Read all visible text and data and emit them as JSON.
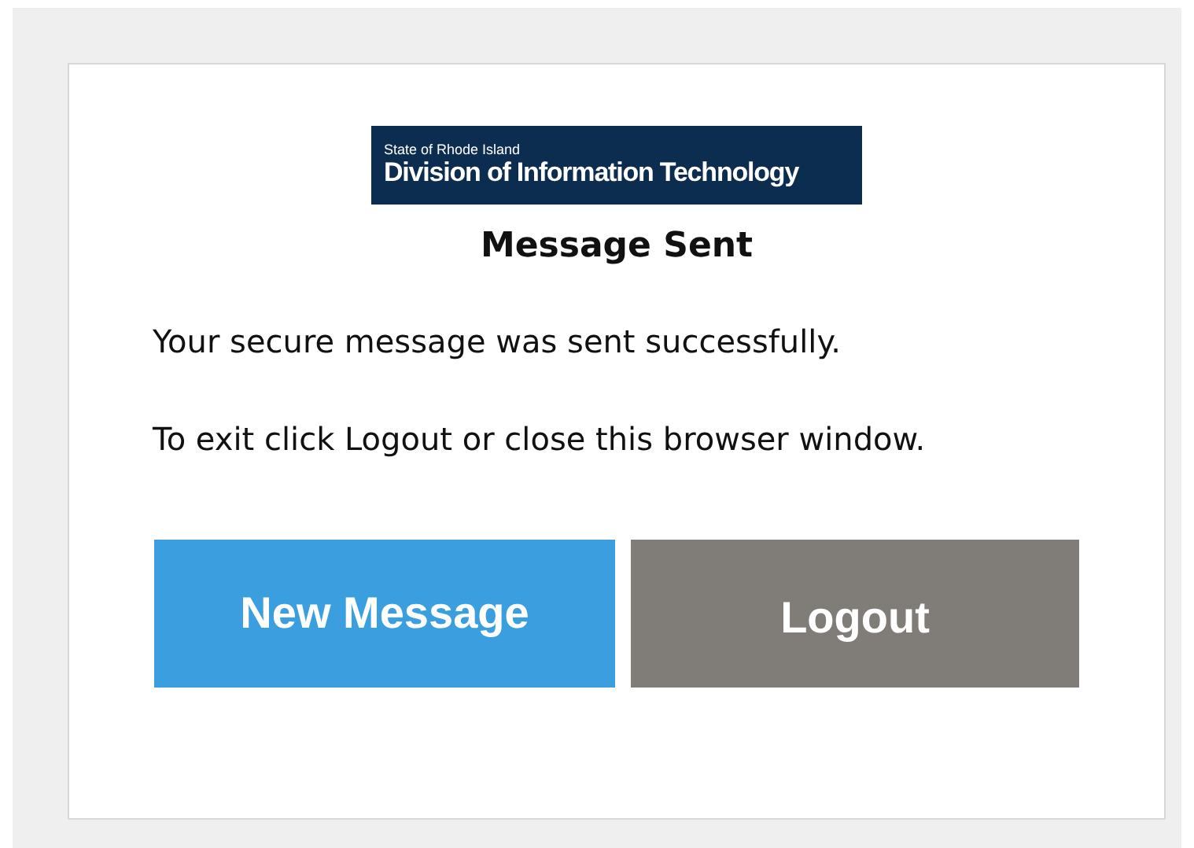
{
  "logo": {
    "small": "State of Rhode Island",
    "large": "Division of Information Technology"
  },
  "title": "Message Sent",
  "paragraphs": [
    "Your secure message was sent successfully.",
    "To exit click Logout or close this browser window."
  ],
  "buttons": [
    {
      "label": "New Message",
      "kind": "primary"
    },
    {
      "label": "Logout",
      "kind": "secondary"
    }
  ]
}
